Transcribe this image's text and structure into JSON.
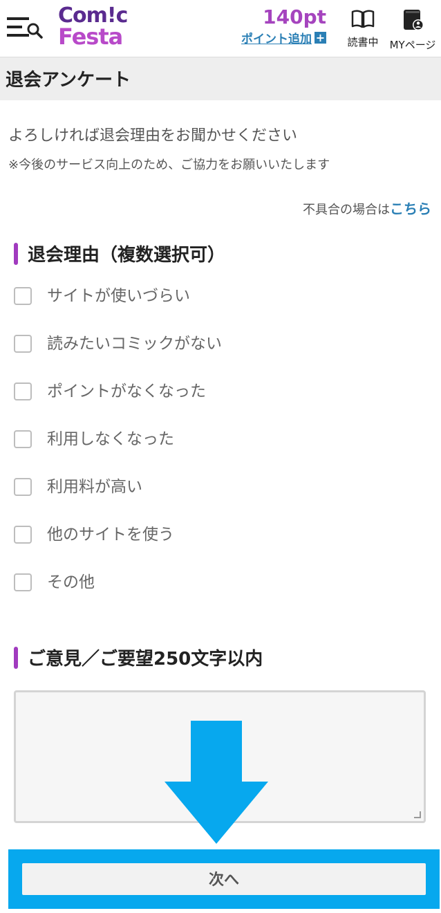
{
  "header": {
    "logo_line1": "Com!c",
    "logo_line2": "Festa",
    "points_value": "140pt",
    "add_points_label": "ポイント追加",
    "reading_label": "読書中",
    "mypage_label": "MYページ"
  },
  "page": {
    "title": "退会アンケート",
    "intro": "よろしければ退会理由をお聞かせください",
    "note": "※今後のサービス向上のため、ご協力をお願いいたします",
    "trouble_prefix": "不具合の場合は",
    "trouble_link": "こちら"
  },
  "reasons": {
    "heading": "退会理由（複数選択可）",
    "options": [
      "サイトが使いづらい",
      "読みたいコミックがない",
      "ポイントがなくなった",
      "利用しなくなった",
      "利用料が高い",
      "他のサイトを使う",
      "その他"
    ]
  },
  "feedback": {
    "heading": "ご意見／ご要望250文字以内",
    "value": ""
  },
  "actions": {
    "next_label": "次へ"
  },
  "colors": {
    "accent_purple": "#a13bbf",
    "link_blue": "#2a7fb5",
    "highlight_blue": "#07a8ee"
  }
}
